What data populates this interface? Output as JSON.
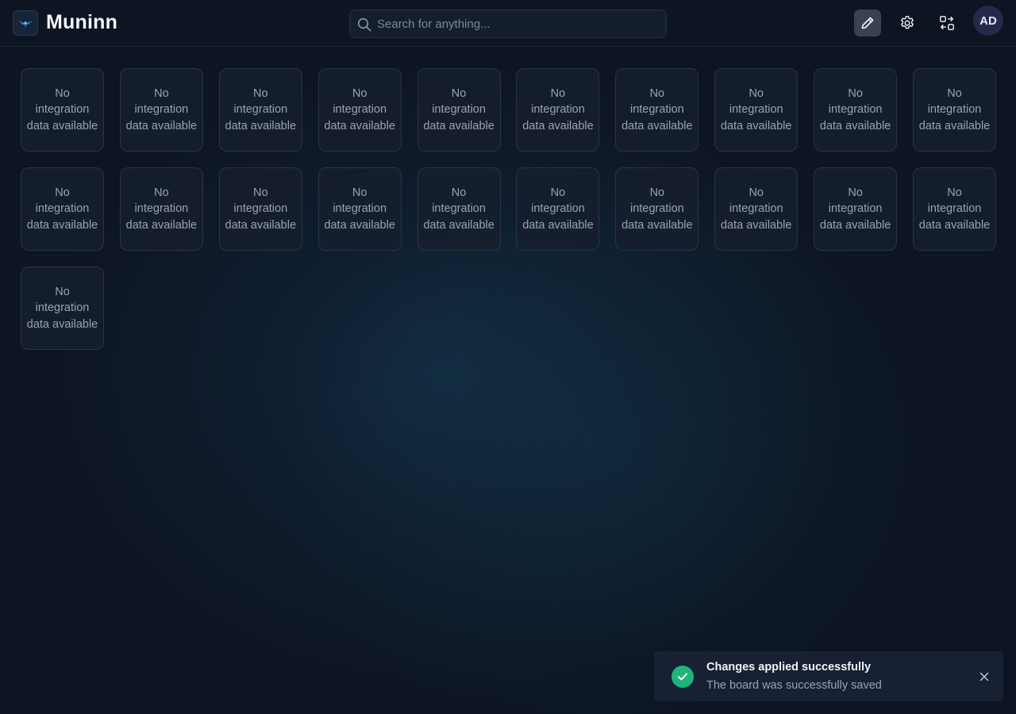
{
  "header": {
    "app_title": "Muninn",
    "logo_icon": "bird-logo-icon",
    "search": {
      "placeholder": "Search for anything...",
      "value": ""
    },
    "actions": {
      "edit_icon": "pencil-icon",
      "settings_icon": "gear-icon",
      "switch_icon": "swap-arrows-icon"
    },
    "avatar_initials": "AD"
  },
  "board": {
    "tiles": [
      {
        "text": "No integration data available"
      },
      {
        "text": "No integration data available"
      },
      {
        "text": "No integration data available"
      },
      {
        "text": "No integration data available"
      },
      {
        "text": "No integration data available"
      },
      {
        "text": "No integration data available"
      },
      {
        "text": "No integration data available"
      },
      {
        "text": "No integration data available"
      },
      {
        "text": "No integration data available"
      },
      {
        "text": "No integration data available"
      },
      {
        "text": "No integration data available"
      },
      {
        "text": "No integration data available"
      },
      {
        "text": "No integration data available"
      },
      {
        "text": "No integration data available"
      },
      {
        "text": "No integration data available"
      },
      {
        "text": "No integration data available"
      },
      {
        "text": "No integration data available"
      },
      {
        "text": "No integration data available"
      },
      {
        "text": "No integration data available"
      },
      {
        "text": "No integration data available"
      },
      {
        "text": "No integration data available"
      }
    ]
  },
  "toast": {
    "title": "Changes applied successfully",
    "message": "The board was successfully saved",
    "status_icon": "check-circle-icon",
    "close_icon": "close-icon",
    "status_color": "#1fb57a"
  },
  "colors": {
    "background": "#0d1422",
    "tile_border": "#2a3446",
    "accent_blue": "#2f8fd6"
  }
}
